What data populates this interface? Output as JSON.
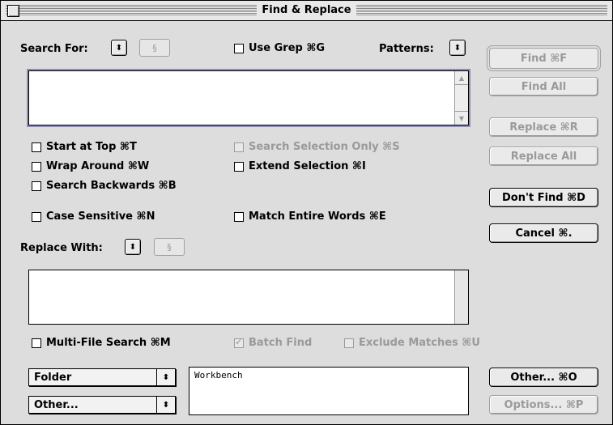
{
  "window": {
    "title": "Find & Replace"
  },
  "search": {
    "label": "Search For:",
    "section_symbol": "§",
    "use_grep": "Use Grep ⌘G",
    "patterns_label": "Patterns:",
    "text": ""
  },
  "options": {
    "start_at_top": "Start at Top ⌘T",
    "wrap_around": "Wrap Around ⌘W",
    "search_backwards": "Search Backwards ⌘B",
    "case_sensitive": "Case Sensitive ⌘N",
    "search_selection_only": "Search Selection Only ⌘S",
    "extend_selection": "Extend Selection ⌘I",
    "match_entire_words": "Match Entire Words ⌘E"
  },
  "replace": {
    "label": "Replace With:",
    "section_symbol": "§",
    "text": ""
  },
  "multi": {
    "multi_file_search": "Multi-File Search ⌘M",
    "batch_find": "Batch Find",
    "exclude_matches": "Exclude Matches ⌘U"
  },
  "sources": {
    "folder": "Folder",
    "other": "Other...",
    "list_item": "Workbench"
  },
  "buttons": {
    "find": "Find ⌘F",
    "find_all": "Find All",
    "replace": "Replace ⌘R",
    "replace_all": "Replace All",
    "dont_find": "Don't Find ⌘D",
    "cancel": "Cancel ⌘.",
    "other": "Other... ⌘O",
    "options": "Options... ⌘P"
  },
  "icons": {
    "popup_arrows": "⬍",
    "scroll_up": "▲",
    "scroll_down": "▼"
  }
}
